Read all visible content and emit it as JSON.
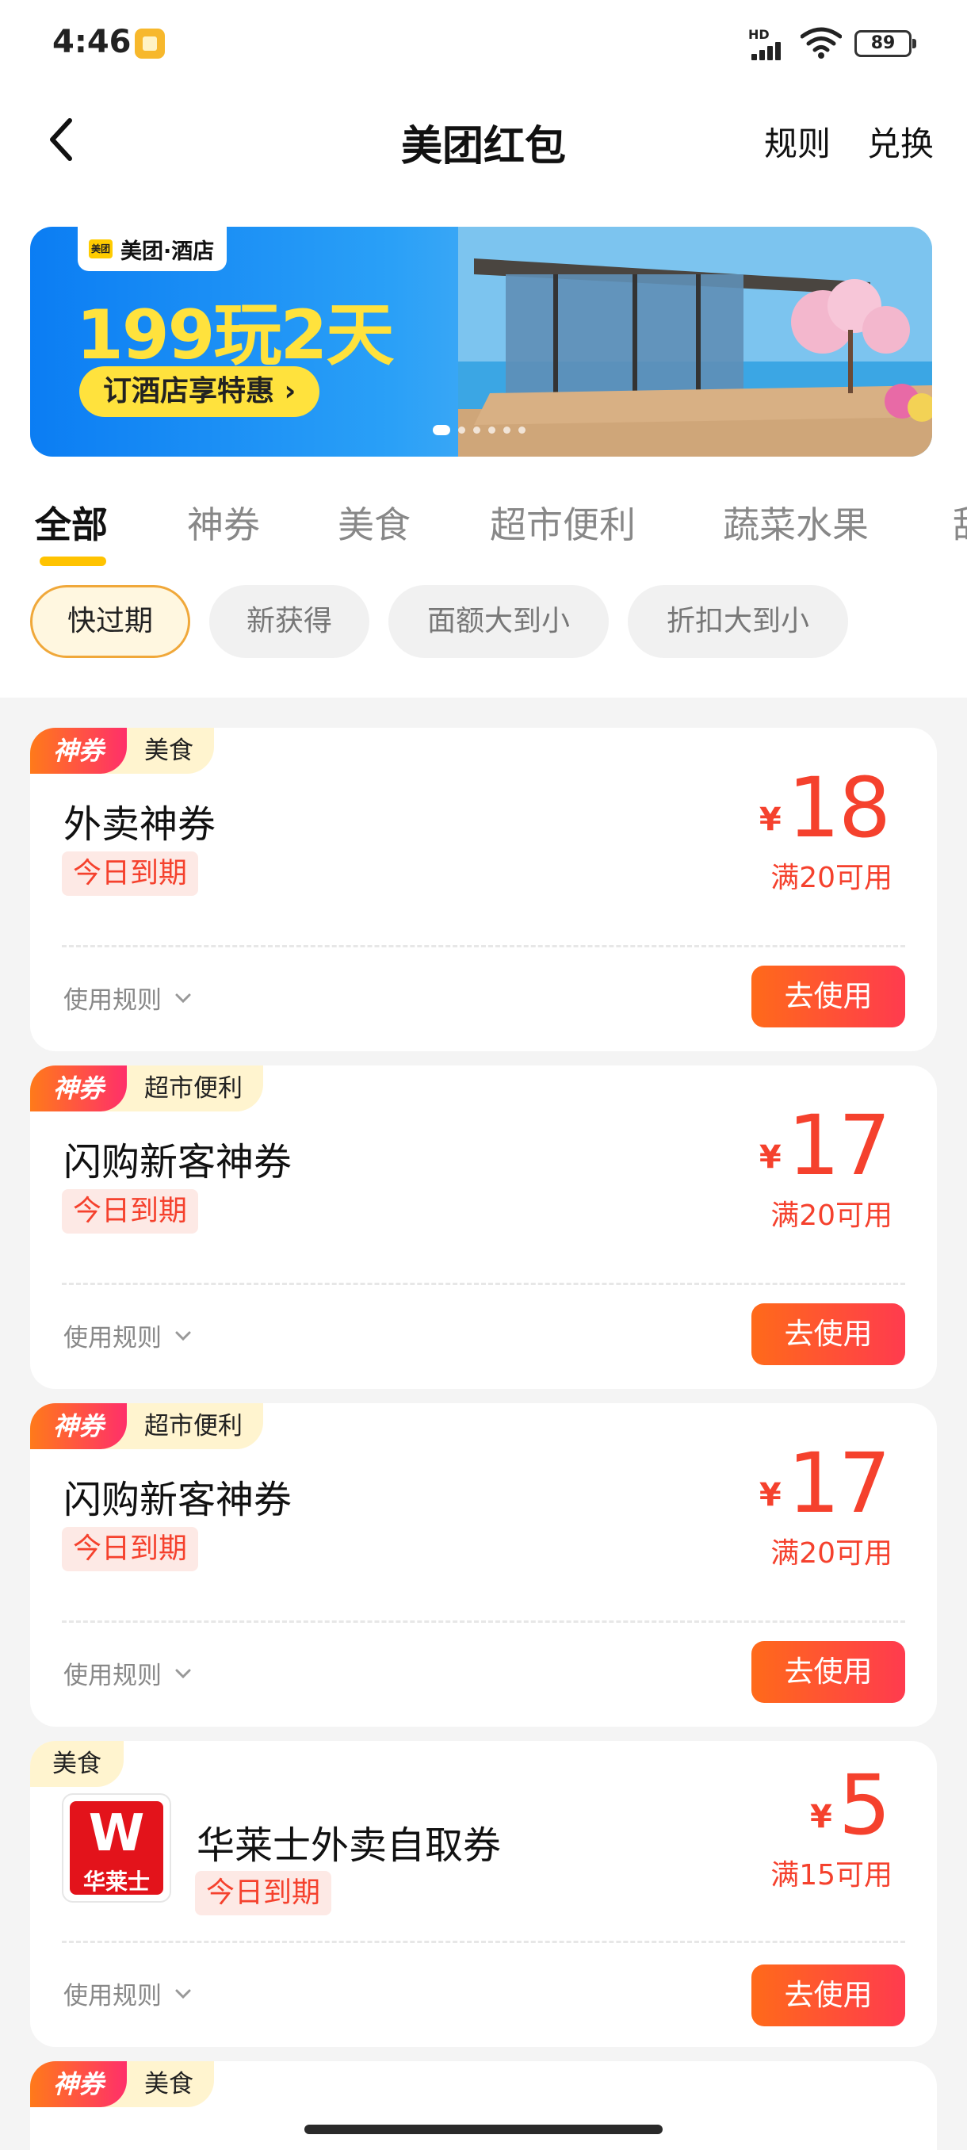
{
  "status": {
    "time": "4:46",
    "network": "HD",
    "battery": "89"
  },
  "nav": {
    "title": "美团红包",
    "rules_label": "规则",
    "exchange_label": "兑换"
  },
  "banner": {
    "brand": "美团·酒店",
    "logo_text": "美团",
    "headline": "199玩2天",
    "cta": "订酒店享特惠 ›"
  },
  "tabs": [
    "全部",
    "神券",
    "美食",
    "超市便利",
    "蔬菜水果",
    "甜"
  ],
  "filters": [
    "快过期",
    "新获得",
    "面额大到小",
    "折扣大到小"
  ],
  "coupons": [
    {
      "badge": "神券",
      "category": "美食",
      "title": "外卖神券",
      "expiry": "今日到期",
      "currency": "¥",
      "amount": "18",
      "condition": "满20可用",
      "rules_label": "使用规则",
      "use_label": "去使用"
    },
    {
      "badge": "神券",
      "category": "超市便利",
      "title": "闪购新客神券",
      "expiry": "今日到期",
      "currency": "¥",
      "amount": "17",
      "condition": "满20可用",
      "rules_label": "使用规则",
      "use_label": "去使用"
    },
    {
      "badge": "神券",
      "category": "超市便利",
      "title": "闪购新客神券",
      "expiry": "今日到期",
      "currency": "¥",
      "amount": "17",
      "condition": "满20可用",
      "rules_label": "使用规则",
      "use_label": "去使用"
    },
    {
      "category": "美食",
      "title": "华莱士外卖自取券",
      "logo_w": "W",
      "logo_text": "华莱士",
      "expiry": "今日到期",
      "currency": "¥",
      "amount": "5",
      "condition": "满15可用",
      "rules_label": "使用规则",
      "use_label": "去使用"
    },
    {
      "badge": "神券",
      "category": "美食"
    }
  ],
  "colors": {
    "accent": "#ffc300",
    "price": "#f5412d",
    "button_start": "#ff6a1a",
    "button_end": "#ff3b4e"
  }
}
